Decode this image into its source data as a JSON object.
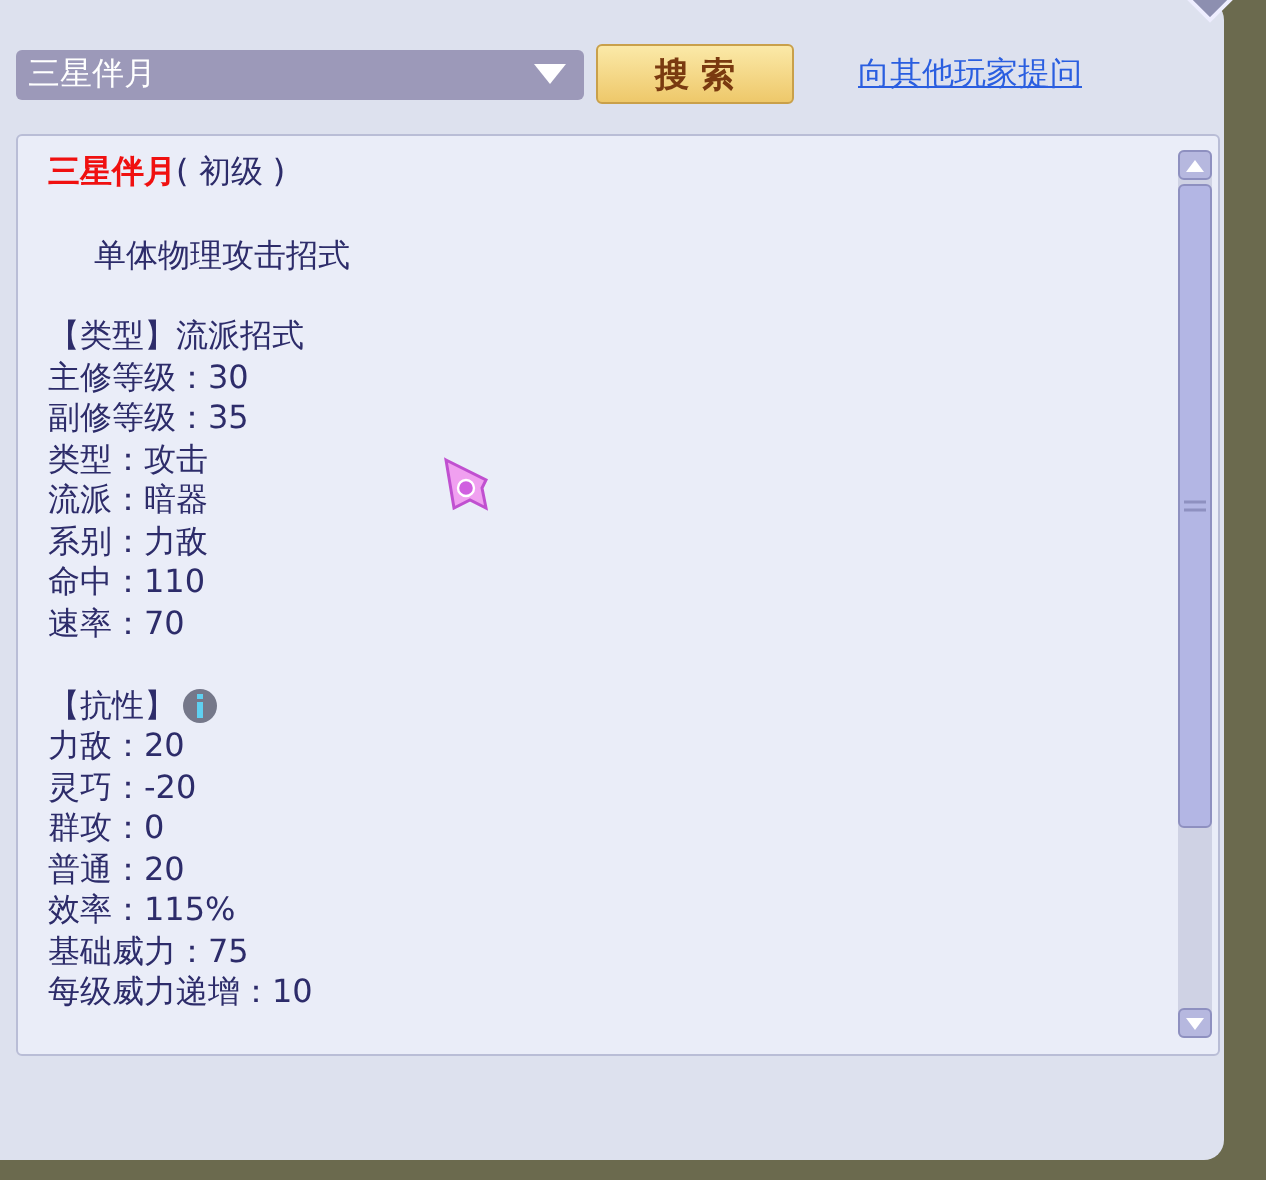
{
  "search": {
    "value": "三星伴月",
    "button": "搜 索"
  },
  "link": "向其他玩家提问",
  "detail": {
    "name": "三星伴月",
    "level": "( 初级 )",
    "description": "单体物理攻击招式",
    "sections": [
      {
        "heading": "【类型】流派招式",
        "info": false,
        "rows": [
          "主修等级：30",
          "副修等级：35",
          "类型：攻击",
          "流派：暗器",
          "系别：力敌",
          "命中：110",
          "速率：70"
        ]
      },
      {
        "heading": "【抗性】",
        "info": true,
        "rows": [
          "力敌：20",
          "灵巧：-20",
          "群攻：0",
          "普通：20",
          "效率：115%",
          "基础威力：75",
          "每级威力递增：10"
        ]
      }
    ]
  }
}
